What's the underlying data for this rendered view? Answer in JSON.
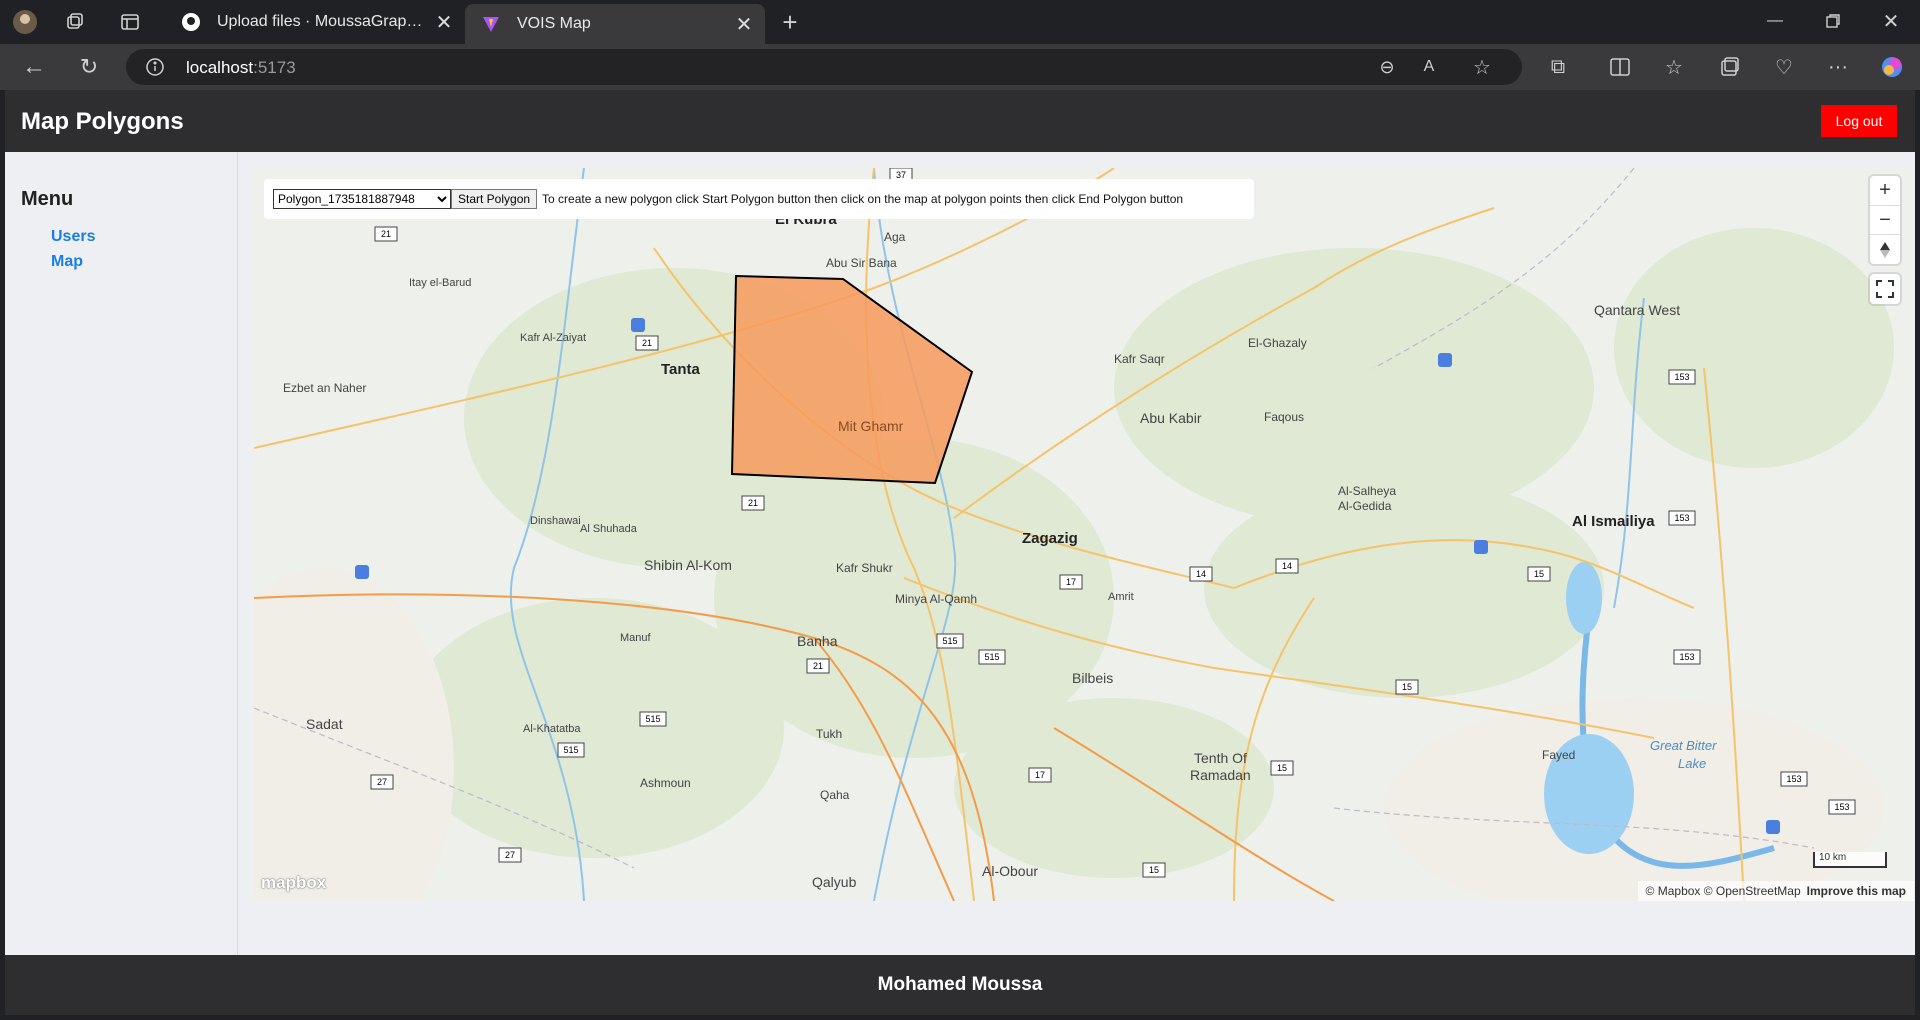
{
  "browser": {
    "tabs": [
      {
        "label": "Upload files · MoussaGraphicsPro",
        "active": false
      },
      {
        "label": "VOIS Map",
        "active": true
      }
    ],
    "url_host": "localhost",
    "url_port": ":5173"
  },
  "header": {
    "title": "Map Polygons",
    "logout_label": "Log out"
  },
  "sidebar": {
    "title": "Menu",
    "items": [
      {
        "label": "Users"
      },
      {
        "label": "Map"
      }
    ]
  },
  "map": {
    "selected_polygon": "Polygon_1735181887948",
    "start_button": "Start Polygon",
    "hint": "To create a new polygon click Start Polygon button then click on the map at polygon points then click End Polygon button",
    "zoom_in": "+",
    "zoom_out": "−",
    "logo": "mapbox",
    "attribution": "© Mapbox © OpenStreetMap",
    "improve": "Improve this map",
    "scale": "10 km",
    "polygon_color": "#f79a5c",
    "places": {
      "el_kubra": "El Kubra",
      "aga": "Aga",
      "abu_sir_bana": "Abu Sir Bana",
      "itay_el_barud": "Itay el-Barud",
      "kafr_al_zaiyat": "Kafr Al-Zaiyat",
      "tanta": "Tanta",
      "ezbet_an_naher": "Ezbet an Naher",
      "mit_ghamr": "Mit Ghamr",
      "kafr_saqr": "Kafr Saqr",
      "el_ghazaly": "El-Ghazaly",
      "qantara_west": "Qantara West",
      "abu_kabir": "Abu Kabir",
      "faqous": "Faqous",
      "al_salheya": "Al-Salheya",
      "al_gedida": "Al-Gedida",
      "al_ismailiya": "Al Ismailiya",
      "dinshawai": "Dinshawai",
      "al_shuhada": "Al Shuhada",
      "shibin_al_kom": "Shibin Al-Kom",
      "kafr_shukr": "Kafr Shukr",
      "zagazig": "Zagazig",
      "minya_al_qamh": "Minya Al-Qamh",
      "amrit": "Amrit",
      "manuf": "Manuf",
      "banha": "Banha",
      "bilbeis": "Bilbeis",
      "sadat": "Sadat",
      "al_khatatba": "Al-Khatatba",
      "tukh": "Tukh",
      "ashmoun": "Ashmoun",
      "tenth_of_ramadan_1": "Tenth Of",
      "tenth_of_ramadan_2": "Ramadan",
      "fayed": "Fayed",
      "great_bitter_lake_1": "Great Bitter",
      "great_bitter_lake_2": "Lake",
      "qaha": "Qaha",
      "al_obour": "Al-Obour",
      "qalyub": "Qalyub"
    },
    "road_shields": {
      "r21_a": "21",
      "r21_b": "21",
      "r21_c": "21",
      "r21_d": "21",
      "r37": "37",
      "r153_a": "153",
      "r153_b": "153",
      "r153_c": "153",
      "r153_d": "153",
      "r153_e": "153",
      "r14_a": "14",
      "r14_b": "14",
      "r15_a": "15",
      "r15_b": "15",
      "r15_c": "15",
      "r15_d": "15",
      "r17_a": "17",
      "r17_b": "17",
      "r515_a": "515",
      "r515_b": "515",
      "r515_c": "515",
      "r515_d": "515",
      "r27_a": "27",
      "r27_b": "27"
    }
  },
  "footer": {
    "name": "Mohamed Moussa"
  }
}
